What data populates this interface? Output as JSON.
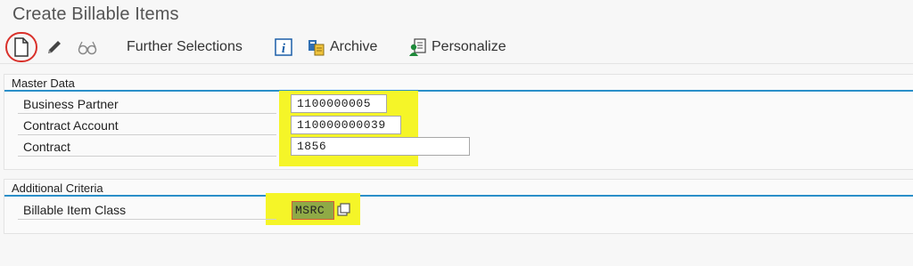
{
  "window": {
    "title": "Create Billable Items"
  },
  "toolbar": {
    "new_icon": "new-document-icon",
    "edit_icon": "pencil-icon",
    "display_icon": "glasses-icon",
    "further_selections_label": "Further Selections",
    "info_icon": "info-icon",
    "archive_label": "Archive",
    "personalize_label": "Personalize"
  },
  "master_data": {
    "header": "Master Data",
    "fields": [
      {
        "label": "Business Partner",
        "value": "1100000005"
      },
      {
        "label": "Contract Account",
        "value": "110000000039"
      },
      {
        "label": "Contract",
        "value": "1856"
      }
    ]
  },
  "additional_criteria": {
    "header": "Additional Criteria",
    "fields": [
      {
        "label": "Billable Item Class",
        "value": "MSRC"
      }
    ]
  },
  "colors": {
    "highlight": "#f5f528",
    "section_rule": "#2a8fc9",
    "circle_annotation": "#d9312b",
    "selected_value_bg": "#8faa46"
  }
}
